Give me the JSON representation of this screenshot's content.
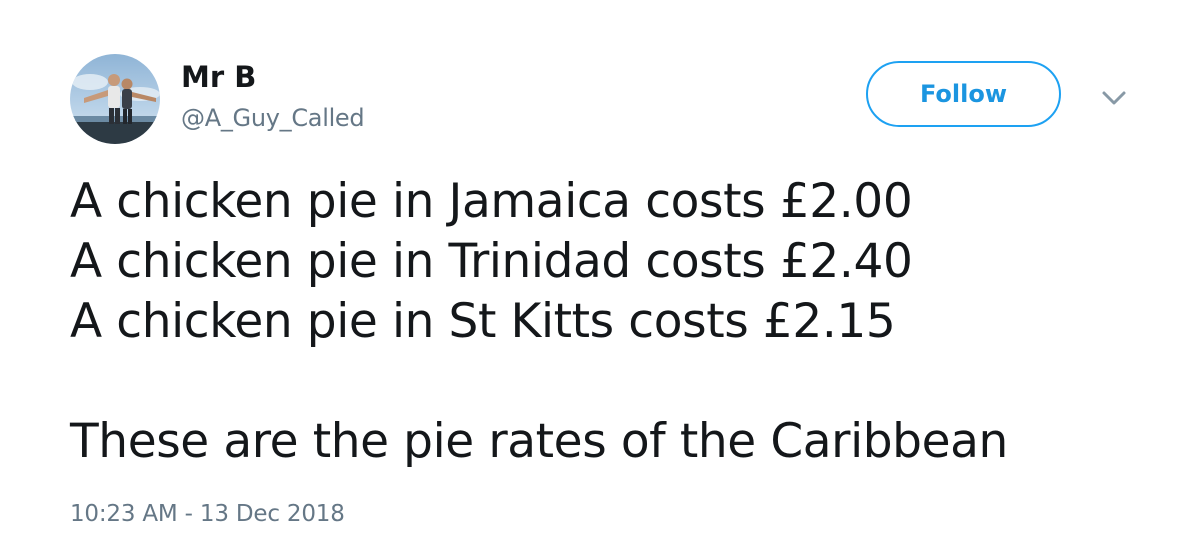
{
  "user": {
    "display_name": "Mr B",
    "handle": "@A_Guy_Called"
  },
  "actions": {
    "follow_label": "Follow",
    "more_icon": "chevron-down-icon"
  },
  "tweet": {
    "lines": [
      "A chicken pie in Jamaica costs £2.00",
      "A chicken pie in Trinidad costs £2.40",
      "A chicken pie in St Kitts costs £2.15",
      "These are the pie rates of the Caribbean"
    ],
    "timestamp": "10:23 AM - 13 Dec 2018"
  },
  "colors": {
    "accent": "#1da1f2",
    "accent_text": "#1b95e0",
    "secondary_text": "#657786",
    "primary_text": "#14171a"
  }
}
